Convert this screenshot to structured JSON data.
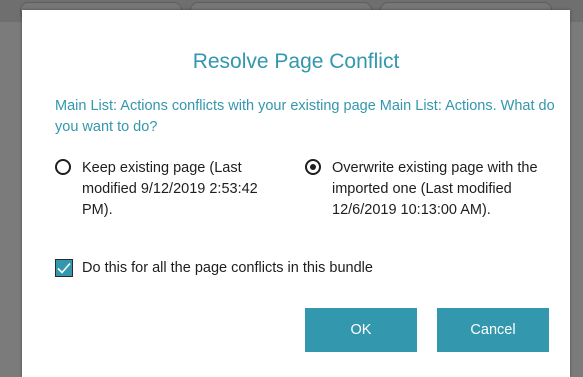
{
  "dialog": {
    "title": "Resolve Page Conflict",
    "message": "Main List: Actions conflicts with your existing page Main List: Actions. What do you want to do?",
    "options": [
      {
        "label": "Keep existing page (Last modified 9/12/2019 2:53:42 PM).",
        "selected": false
      },
      {
        "label": "Overwrite existing page with the imported one (Last modified 12/6/2019 10:13:00 AM).",
        "selected": true
      }
    ],
    "apply_all": {
      "label": "Do this for all the page conflicts in this bundle",
      "checked": true
    },
    "buttons": {
      "ok": "OK",
      "cancel": "Cancel"
    }
  },
  "colors": {
    "accent": "#3397ad",
    "text": "#1e1e1e",
    "backdrop": "#7b7b7b"
  }
}
